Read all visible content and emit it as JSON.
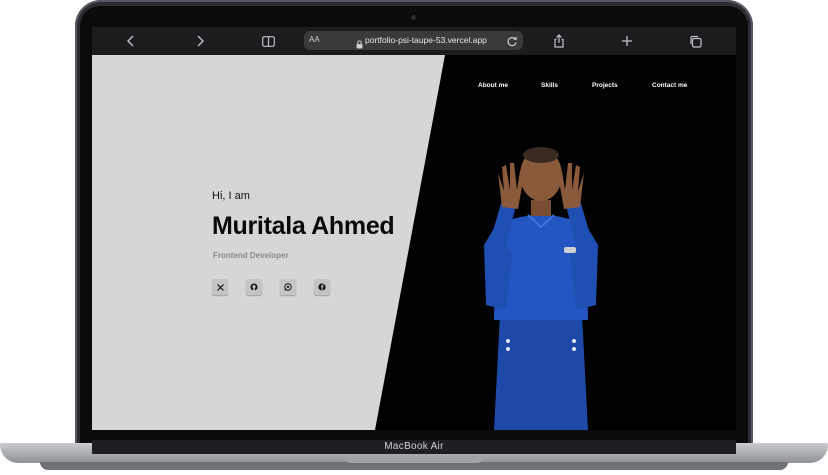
{
  "device": {
    "label": "MacBook Air"
  },
  "browser": {
    "url_text_size_label": "AA",
    "url": "portfolio-psi-taupe-53.vercel.app",
    "icons": [
      "back-icon",
      "forward-icon",
      "book-icon",
      "lock-icon",
      "reload-icon",
      "share-icon",
      "plus-icon",
      "tabs-icon"
    ]
  },
  "nav": {
    "items": [
      "About me",
      "Skills",
      "Projects",
      "Contact me"
    ]
  },
  "hero": {
    "greeting": "Hi, I am",
    "name": "Muritala Ahmed",
    "role": "Frontend Developer"
  },
  "social": {
    "icons": [
      "x-icon",
      "github-icon",
      "whatsapp-icon",
      "facebook-icon"
    ]
  },
  "colors": {
    "light_panel": "#d6d6d6",
    "dark_panel": "#000000",
    "toolbar": "#1c1c1e",
    "shirt": "#1f4fb3"
  }
}
